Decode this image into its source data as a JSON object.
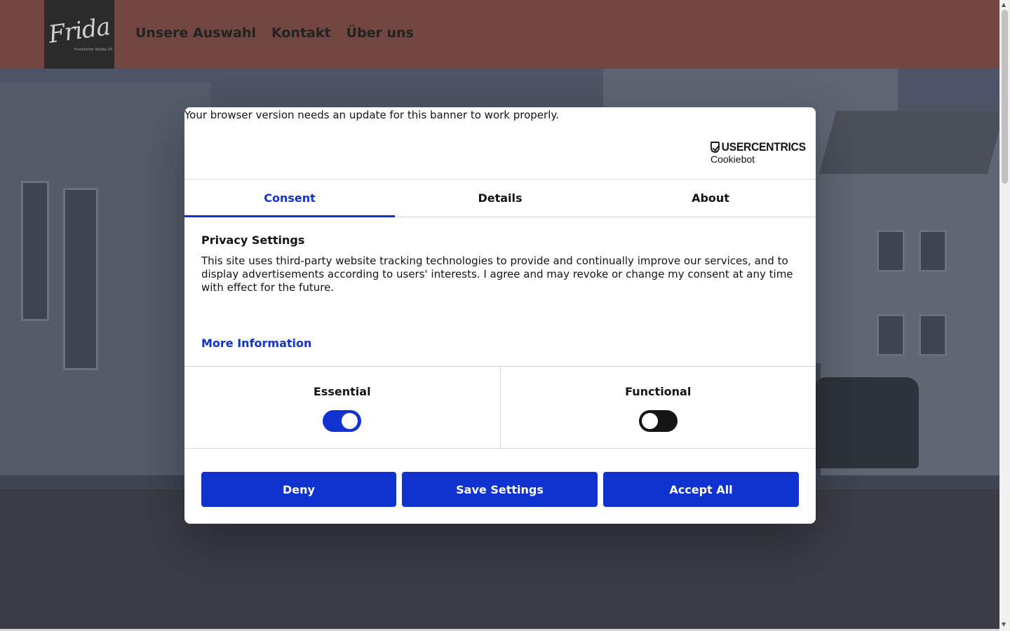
{
  "header": {
    "logo": {
      "word": "Frida",
      "sub": "Frankfurter Straße 20"
    },
    "nav": [
      {
        "label": "Unsere Auswahl"
      },
      {
        "label": "Kontakt"
      },
      {
        "label": "Über uns"
      }
    ]
  },
  "cookie_dialog": {
    "browser_notice": "Your browser version needs an update for this banner to work properly.",
    "provider_logo": {
      "name": "USERCENTRICS",
      "product": "Cookiebot"
    },
    "tabs": [
      {
        "label": "Consent",
        "active": true
      },
      {
        "label": "Details",
        "active": false
      },
      {
        "label": "About",
        "active": false
      }
    ],
    "title": "Privacy Settings",
    "text": "This site uses third-party website tracking technologies to provide and continually improve our services, and to display advertisements according to users' interests. I agree and may revoke or change my consent at any time with effect for the future.",
    "more_info_label": "More Information",
    "toggles": [
      {
        "label": "Essential",
        "enabled": true
      },
      {
        "label": "Functional",
        "enabled": false
      }
    ],
    "buttons": {
      "deny": "Deny",
      "save": "Save Settings",
      "accept": "Accept All"
    }
  },
  "colors": {
    "header_bg": "#734741",
    "accent": "#1032cf",
    "text": "#141414"
  },
  "icons": [
    "shield-check-icon",
    "scroll-up-arrow-icon",
    "scroll-down-arrow-icon"
  ]
}
